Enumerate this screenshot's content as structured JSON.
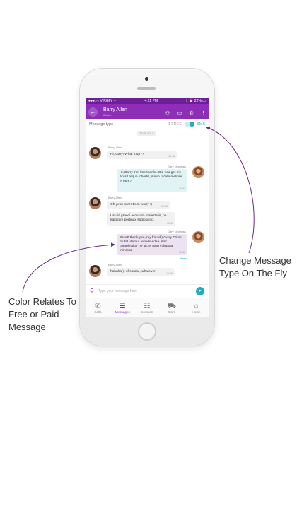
{
  "status_bar": {
    "carrier": "●●●○○ VIRGIN ᯤ",
    "time": "4:21 PM",
    "battery": "ᛒ ⏰ 22% ▭"
  },
  "header": {
    "back_icon": "back-arrow-icon",
    "name": "Barry Allen",
    "presence": "Online"
  },
  "message_type": {
    "label": "Message type",
    "free": "FREE",
    "sms": "SMS",
    "selected": "SMS"
  },
  "chat": {
    "date": "12.05.2013",
    "messages": [
      {
        "sender": "Barry Allen",
        "text": "Hi, Gary! What`s up??",
        "time": "10:43"
      },
      {
        "sender": "Gary Newman",
        "text": "Hi, Barry. I`m fine thanks. Did you get my An sit reque lobortis, sumo facete meliore ei eum?",
        "time": "10:43"
      },
      {
        "sender": "Barry Allen",
        "text": "Oh yeah sure! Dont worry :)",
        "time": "10:45"
      },
      {
        "text": "Usu id graeci accusata maiestatis, ne luptatum pertinax sadipscing.",
        "time": "10:45"
      },
      {
        "sender": "Gary Newman",
        "text": "Great! thank you, my friend:) Avery Pri ne mutat utamur repudiandae, stet complectitur ne sit, ei nam voluptua inimicus.",
        "time": "10:47"
      },
      {
        "seen": "Seen"
      },
      {
        "sender": "Barry Allen",
        "text": "hahaha )) of course, whatever!",
        "time": "10:56"
      }
    ]
  },
  "composer": {
    "placeholder": "Type your message here"
  },
  "tabs": [
    {
      "label": "Calls",
      "icon": "phone-icon"
    },
    {
      "label": "Messages",
      "icon": "messages-icon"
    },
    {
      "label": "Contacts",
      "icon": "contacts-icon"
    },
    {
      "label": "Store",
      "icon": "cart-icon"
    },
    {
      "label": "Home",
      "icon": "home-icon"
    }
  ],
  "annotations": {
    "right": [
      "Change Message",
      "Type On The Fly"
    ],
    "left": [
      "Color Relates To",
      "Free or Paid",
      "Message"
    ]
  },
  "colors": {
    "primary": "#8e2db8",
    "accent": "#1eaebf",
    "sms_bubble": "#e0f3f5",
    "free_bubble": "#ece2f2"
  }
}
